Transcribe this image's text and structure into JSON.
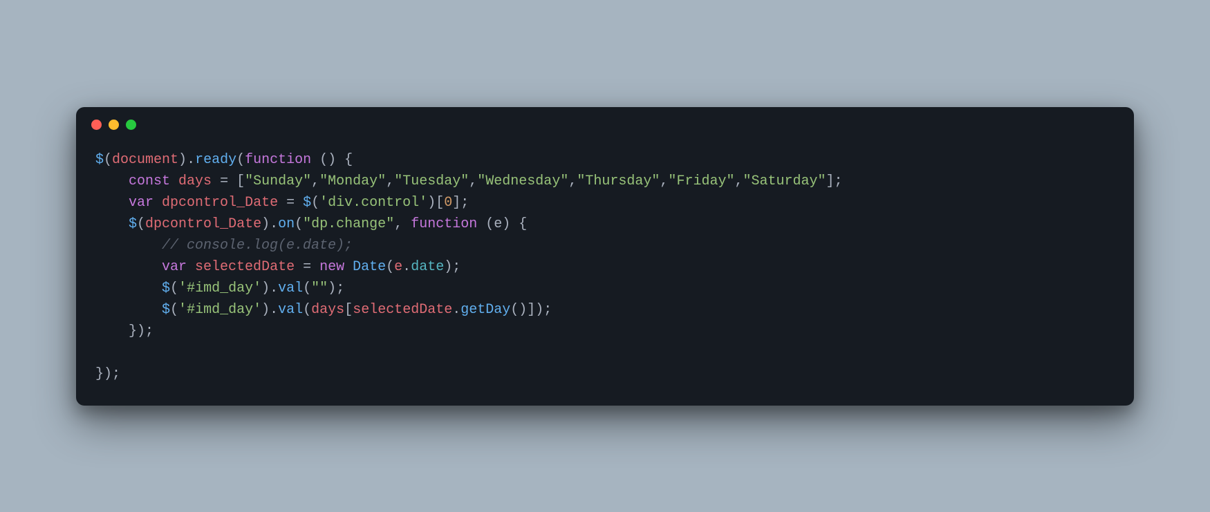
{
  "code": {
    "line1": {
      "dollar": "$",
      "lparen": "(",
      "document": "document",
      "rparen": ")",
      "dot": ".",
      "ready": "ready",
      "lparen2": "(",
      "function": "function",
      "space_parens": " ()",
      "space_brace": " {"
    },
    "line2": {
      "indent": "    ",
      "const": "const",
      "space1": " ",
      "days": "days",
      "eq": " = ",
      "lbracket": "[",
      "q1": "\"",
      "sun": "Sunday",
      "q1b": "\"",
      "c1": ",",
      "q2": "\"",
      "mon": "Monday",
      "q2b": "\"",
      "c2": ",",
      "q3": "\"",
      "tue": "Tuesday",
      "q3b": "\"",
      "c3": ",",
      "q4": "\"",
      "wed": "Wednesday",
      "q4b": "\"",
      "c4": ",",
      "q5": "\"",
      "thu": "Thursday",
      "q5b": "\"",
      "c5": ",",
      "q6": "\"",
      "fri": "Friday",
      "q6b": "\"",
      "c6": ",",
      "q7": "\"",
      "sat": "Saturday",
      "q7b": "\"",
      "rbracket": "]",
      "semi": ";"
    },
    "line3": {
      "indent": "    ",
      "var": "var",
      "space1": " ",
      "dpcontrol": "dpcontrol_Date",
      "eq": " = ",
      "dollar": "$",
      "lparen": "(",
      "q1": "'",
      "divcontrol": "div.control",
      "q2": "'",
      "rparen": ")",
      "lbracket": "[",
      "zero": "0",
      "rbracket": "]",
      "semi": ";"
    },
    "line4": {
      "indent": "    ",
      "dollar": "$",
      "lparen": "(",
      "dpcontrol": "dpcontrol_Date",
      "rparen": ")",
      "dot": ".",
      "on": "on",
      "lparen2": "(",
      "q1": "\"",
      "dpchange": "dp.change",
      "q2": "\"",
      "comma": ", ",
      "function": "function",
      "space_lparen": " (",
      "e": "e",
      "rparen2": ")",
      "space_brace": " {"
    },
    "line5": {
      "indent": "        ",
      "comment": "// console.log(e.date);"
    },
    "line6": {
      "indent": "        ",
      "var": "var",
      "space1": " ",
      "selectedDate": "selectedDate",
      "eq": " = ",
      "new": "new",
      "space2": " ",
      "Date": "Date",
      "lparen": "(",
      "e": "e",
      "dot": ".",
      "date": "date",
      "rparen": ")",
      "semi": ";"
    },
    "line7": {
      "indent": "        ",
      "dollar": "$",
      "lparen": "(",
      "q1": "'",
      "imdday": "#imd_day",
      "q2": "'",
      "rparen": ")",
      "dot": ".",
      "val": "val",
      "lparen2": "(",
      "q3": "\"\"",
      "rparen2": ")",
      "semi": ";"
    },
    "line8": {
      "indent": "        ",
      "dollar": "$",
      "lparen": "(",
      "q1": "'",
      "imdday": "#imd_day",
      "q2": "'",
      "rparen": ")",
      "dot": ".",
      "val": "val",
      "lparen2": "(",
      "days": "days",
      "lbracket": "[",
      "selectedDate": "selectedDate",
      "dot2": ".",
      "getDay": "getDay",
      "parens": "()",
      "rbracket": "]",
      "rparen2": ")",
      "semi": ";"
    },
    "line9": {
      "indent": "    ",
      "closing": "});"
    },
    "line10": {
      "empty": ""
    },
    "line11": {
      "closing": "});"
    }
  }
}
